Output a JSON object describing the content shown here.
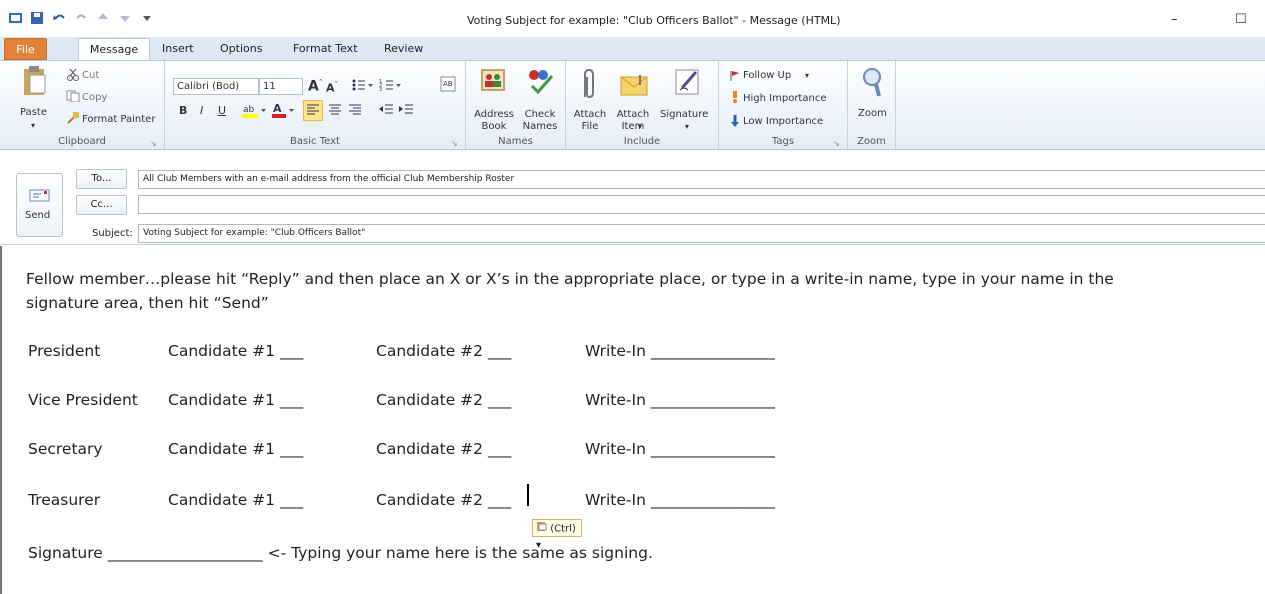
{
  "window": {
    "title": "Voting Subject for example: \"Club Officers Ballot\" - Message (HTML)",
    "minimize": "–",
    "maximize": "☐"
  },
  "tabs": [
    "File",
    "Message",
    "Insert",
    "Options",
    "Format Text",
    "Review"
  ],
  "ribbon": {
    "clipboard": {
      "paste": "Paste",
      "cut": "Cut",
      "copy": "Copy",
      "format_painter": "Format Painter",
      "label": "Clipboard"
    },
    "basic_text": {
      "font": "Calibri (Bod)",
      "size": "11",
      "label": "Basic Text"
    },
    "names": {
      "address_book": "Address Book",
      "check_names": "Check Names",
      "label": "Names"
    },
    "include": {
      "attach_file": "Attach File",
      "attach_item": "Attach Item",
      "signature": "Signature",
      "label": "Include"
    },
    "tags": {
      "follow_up": "Follow Up",
      "high": "High Importance",
      "low": "Low Importance",
      "label": "Tags"
    },
    "zoom": {
      "zoom": "Zoom",
      "label": "Zoom"
    }
  },
  "compose": {
    "send": "Send",
    "to_btn": "To...",
    "cc_btn": "Cc...",
    "subject_label": "Subject:",
    "to_value": "All Club Members with an e-mail address from the official Club Membership Roster",
    "cc_value": "",
    "subject_value": "Voting Subject for example: \"Club Officers Ballot\""
  },
  "body": {
    "intro_line1": "Fellow member…please hit “Reply” and then place an X or X’s in the appropriate place, or type in a write-in name, type in your name in the",
    "intro_line2": "signature area, then hit “Send”",
    "rows": [
      {
        "office": "President",
        "c1": "Candidate #1 ___",
        "c2": "Candidate #2 ___",
        "w": "Write-In ________________"
      },
      {
        "office": "Vice President",
        "c1": "Candidate #1 ___",
        "c2": "Candidate #2 ___",
        "w": "Write-In ________________"
      },
      {
        "office": "Secretary",
        "c1": "Candidate #1 ___",
        "c2": "Candidate #2 ___",
        "w": "Write-In ________________"
      },
      {
        "office": "Treasurer",
        "c1": "Candidate #1 ___",
        "c2": "Candidate #2 ___",
        "w": "Write-In ________________"
      }
    ],
    "signature": "Signature ____________________ <- Typing your name here is the same as signing.",
    "paste_options": "(Ctrl) ▾"
  }
}
